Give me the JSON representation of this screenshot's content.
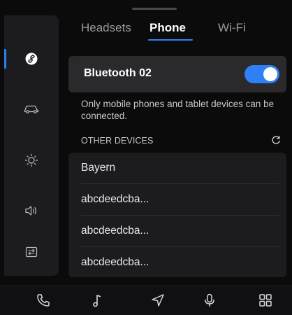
{
  "tabs": [
    {
      "label": "Headsets",
      "active": false
    },
    {
      "label": "Phone",
      "active": true
    },
    {
      "label": "Wi-Fi",
      "active": false
    }
  ],
  "bluetooth": {
    "device_name": "Bluetooth 02",
    "toggle_on": true
  },
  "hint": "Only mobile phones and tablet devices can be connected.",
  "other_devices": {
    "title": "OTHER DEVICES",
    "items": [
      {
        "label": "Bayern"
      },
      {
        "label": "abcdeedcba..."
      },
      {
        "label": "abcdeedcba..."
      },
      {
        "label": "abcdeedcba..."
      }
    ]
  },
  "sidebar": {
    "items": [
      {
        "icon": "link-icon",
        "active": true
      },
      {
        "icon": "car-icon",
        "active": false
      },
      {
        "icon": "brightness-icon",
        "active": false
      },
      {
        "icon": "volume-icon",
        "active": false
      },
      {
        "icon": "system-icon",
        "active": false
      }
    ]
  },
  "dock": {
    "items": [
      {
        "icon": "phone-icon"
      },
      {
        "icon": "music-icon"
      },
      {
        "icon": "navigation-icon"
      },
      {
        "icon": "microphone-icon"
      },
      {
        "icon": "apps-grid-icon"
      }
    ]
  },
  "colors": {
    "accent": "#2f7ff7",
    "background": "#0b0b0c",
    "panel": "#1c1c1e",
    "card": "#2a2a2c"
  }
}
